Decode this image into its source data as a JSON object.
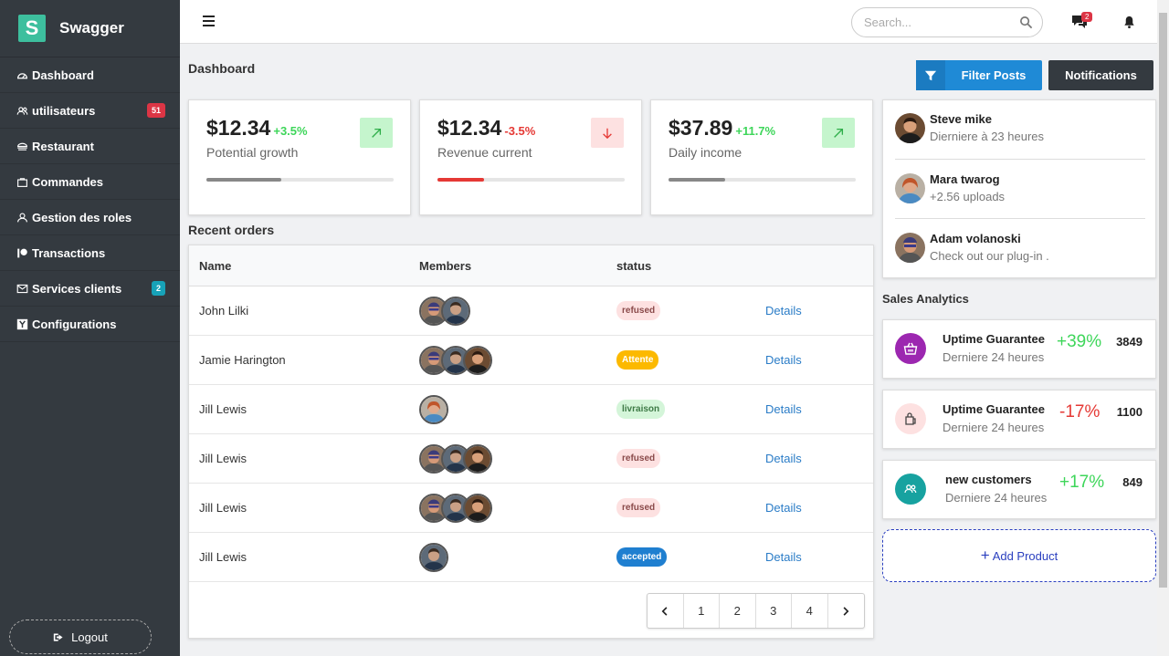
{
  "brand": {
    "logo_letter": "S",
    "name": "Swagger",
    "color": "#3dbf9e"
  },
  "sidebar": {
    "items": [
      {
        "label": "Dashboard",
        "icon": "dashboard-icon"
      },
      {
        "label": "utilisateurs",
        "icon": "users-icon",
        "badge": "51"
      },
      {
        "label": "Restaurant",
        "icon": "restaurant-icon"
      },
      {
        "label": "Commandes",
        "icon": "bag-icon"
      },
      {
        "label": "Gestion des roles",
        "icon": "user-icon"
      },
      {
        "label": "Transactions",
        "icon": "patreon-icon"
      },
      {
        "label": "Services clients",
        "icon": "mail-icon",
        "badge": "2"
      },
      {
        "label": "Configurations",
        "icon": "y-icon"
      }
    ],
    "logout": "Logout"
  },
  "topbar": {
    "search_placeholder": "Search...",
    "chat_badge": "2"
  },
  "main": {
    "title": "Dashboard",
    "filter_button": "Filter Posts",
    "notifications_button": "Notifications",
    "stats": [
      {
        "value": "$12.34",
        "change": "+3.5%",
        "label": "Potential growth",
        "trend": "up",
        "progress": 0.4
      },
      {
        "value": "$12.34",
        "change": "-3.5%",
        "label": "Revenue current",
        "trend": "down",
        "progress": 0.25
      },
      {
        "value": "$37.89",
        "change": "+11.7%",
        "label": "Daily income",
        "trend": "up",
        "progress": 0.3
      }
    ],
    "orders": {
      "title": "Recent orders",
      "headers": [
        "Name",
        "Members",
        "status",
        ""
      ],
      "rows": [
        {
          "name": "John Lilki",
          "members": 2,
          "status": "refused",
          "action": "Details"
        },
        {
          "name": "Jamie Harington",
          "members": 3,
          "status": "Attente",
          "action": "Details"
        },
        {
          "name": "Jill Lewis",
          "members": 1,
          "status": "livraison",
          "action": "Details"
        },
        {
          "name": "Jill Lewis",
          "members": 3,
          "status": "refused",
          "action": "Details"
        },
        {
          "name": "Jill Lewis",
          "members": 3,
          "status": "refused",
          "action": "Details"
        },
        {
          "name": "Jill Lewis",
          "members": 1,
          "status": "accepted",
          "action": "Details"
        }
      ],
      "pages": [
        "1",
        "2",
        "3",
        "4"
      ]
    }
  },
  "right": {
    "people": [
      {
        "name": "Steve mike",
        "sub": "Dierniere à 23 heures"
      },
      {
        "name": "Mara twarog",
        "sub": "+2.56 uploads"
      },
      {
        "name": "Adam volanoski",
        "sub": "Check out our plug-in ."
      }
    ],
    "analytics_title": "Sales Analytics",
    "sales": [
      {
        "title": "Uptime Guarantee",
        "sub": "Derniere 24 heures",
        "pct": "+39%",
        "num": "3849",
        "icon": "basket-icon",
        "color": "#9c27b0"
      },
      {
        "title": "Uptime Guarantee",
        "sub": "Derniere 24 heures",
        "pct": "-17%",
        "num": "1100",
        "icon": "bag-icon",
        "color": "#fde1e1"
      },
      {
        "title": "new customers",
        "sub": "Derniere 24 heures",
        "pct": "+17%",
        "num": "849",
        "icon": "customers-icon",
        "color": "#17a2a0"
      }
    ],
    "add_product": "Add Product"
  },
  "colors": {
    "up": "#3ed65a",
    "down": "#e53935",
    "link": "#2a7cc7"
  }
}
